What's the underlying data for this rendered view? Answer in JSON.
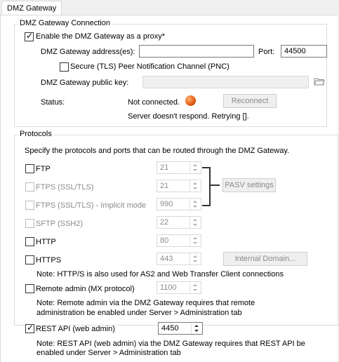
{
  "tab": {
    "label": "DMZ Gateway"
  },
  "connection": {
    "title": "DMZ Gateway Connection",
    "enable_label": "Enable the DMZ Gateway as a proxy*",
    "address_label": "DMZ Gateway address(es):",
    "address_value": "",
    "port_label": "Port:",
    "port_value": "44500",
    "secure_label": "Secure (TLS) Peer Notification Channel (PNC)",
    "public_key_label": "DMZ Gateway public key:",
    "public_key_value": "",
    "status_label": "Status:",
    "status_value": "Not connected.",
    "status_color": "#e05a10",
    "reconnect_label": "Reconnect",
    "server_message": "Server doesn't respond. Retrying []."
  },
  "protocols": {
    "title": "Protocols",
    "description": "Specify the protocols and ports that can be routed through the DMZ Gateway.",
    "ftp": {
      "label": "FTP",
      "port": "21"
    },
    "ftps": {
      "label": "FTPS (SSL/TLS)",
      "port": "21"
    },
    "ftps_implicit": {
      "label": "FTPS (SSL/TLS) - Implicit mode",
      "port": "990"
    },
    "sftp": {
      "label": "SFTP (SSH2)",
      "port": "22"
    },
    "http": {
      "label": "HTTP",
      "port": "80"
    },
    "https": {
      "label": "HTTPS",
      "port": "443"
    },
    "pasv_label": "PASV settings",
    "internal_domain_label": "Internal Domain...",
    "http_note": "Note: HTTP/S is also used for AS2 and Web Transfer Client connections",
    "remote_admin": {
      "label": "Remote admin (MX protocol)",
      "port": "1100"
    },
    "remote_note_1": "Note: Remote admin via the DMZ Gateway requires that remote",
    "remote_note_2": "administration be enabled under Server > Administration tab"
  },
  "rest": {
    "label": "REST API (web admin)",
    "port": "4450",
    "note_1": "Note: REST API (web admin) via the DMZ Gateway requires that REST API be",
    "note_2": "enabled under Server > Administration tab"
  }
}
